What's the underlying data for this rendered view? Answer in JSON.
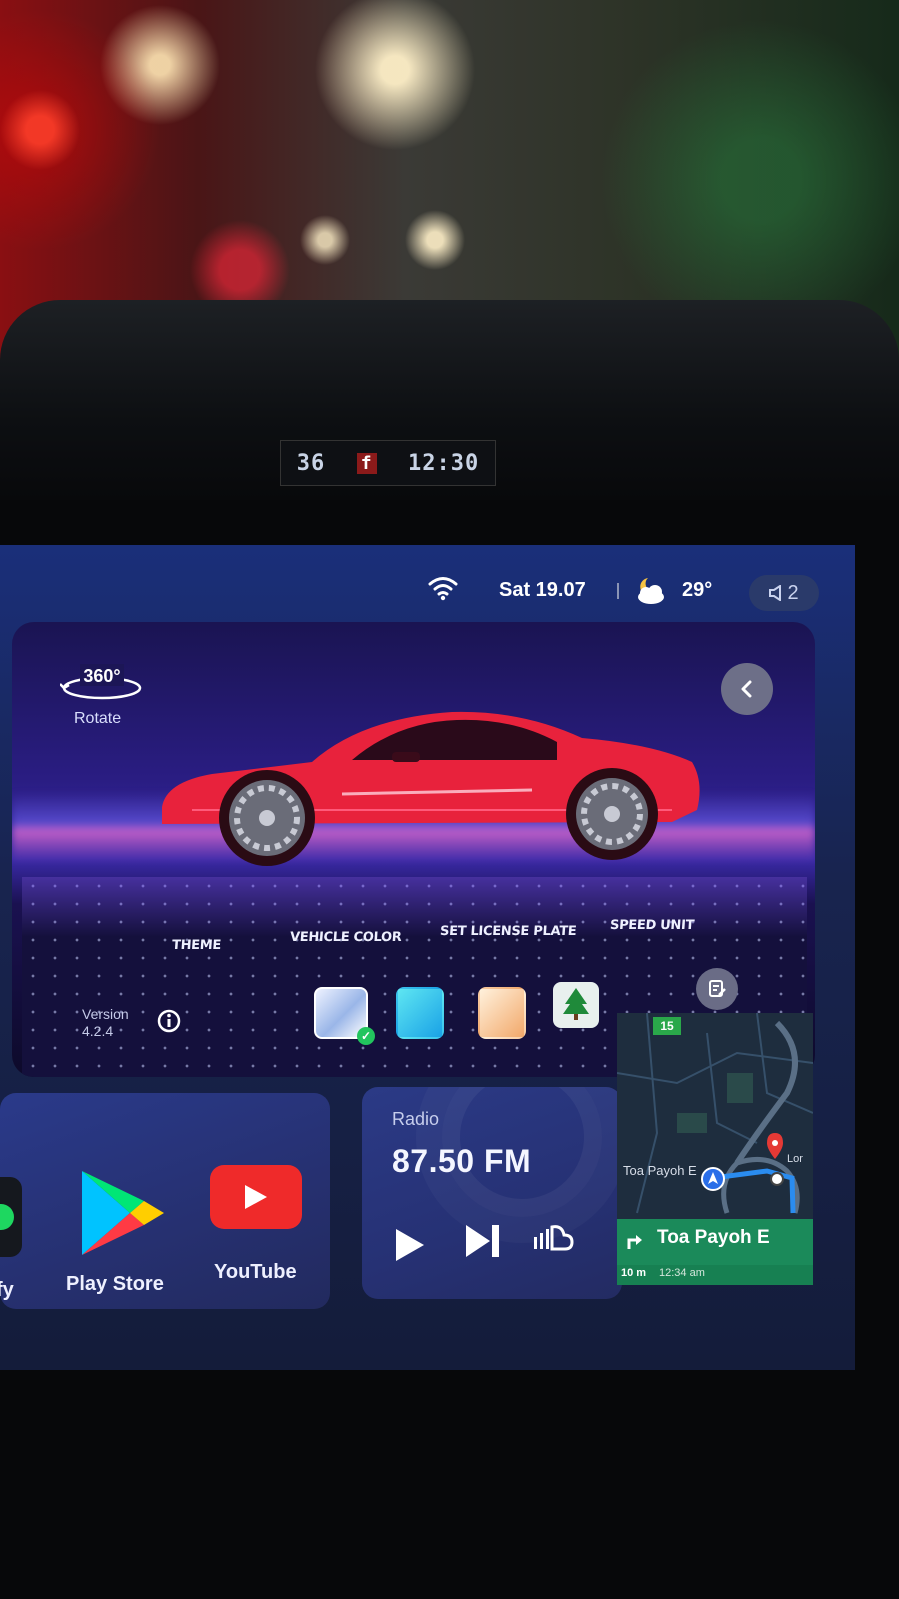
{
  "hud": {
    "left": "36",
    "badge": "f",
    "time": "12:30"
  },
  "status": {
    "wifi_icon": "wifi-icon",
    "date": "Sat 19.07",
    "weather_icon": "partly-cloudy-night-icon",
    "temperature": "29°",
    "volume_icon": "speaker-icon",
    "volume_level": "2"
  },
  "car_widget": {
    "rotate_badge": "360°",
    "rotate_label": "Rotate",
    "back_icon": "chevron-left-icon",
    "car_color": "#e8223c",
    "tabs": [
      {
        "label": "THEME"
      },
      {
        "label": "VEHICLE COLOR"
      },
      {
        "label": "SET LICENSE PLATE"
      },
      {
        "label": "SPEED UNIT"
      }
    ],
    "version_label": "Version",
    "version_number": "4.2.4",
    "theme_swatches": [
      {
        "name": "light-theme",
        "selected": true
      },
      {
        "name": "cyan-theme",
        "selected": false
      },
      {
        "name": "peach-theme",
        "selected": false
      },
      {
        "name": "christmas-tree-theme",
        "selected": false
      }
    ]
  },
  "apps": [
    {
      "label": "fy",
      "icon": "spotify-icon"
    },
    {
      "label": "Play Store",
      "icon": "play-store-icon"
    },
    {
      "label": "YouTube",
      "icon": "youtube-icon"
    }
  ],
  "radio": {
    "title": "Radio",
    "frequency": "87.50 FM",
    "controls": [
      "play-icon",
      "skip-next-icon",
      "soundcloud-icon"
    ]
  },
  "navigation": {
    "speed_limit": "15",
    "map_street": "Toa Payoh E",
    "map_label_right": "Lor",
    "next_street": "Toa Payoh E",
    "distance": "10 m",
    "eta": "12:34 am"
  }
}
